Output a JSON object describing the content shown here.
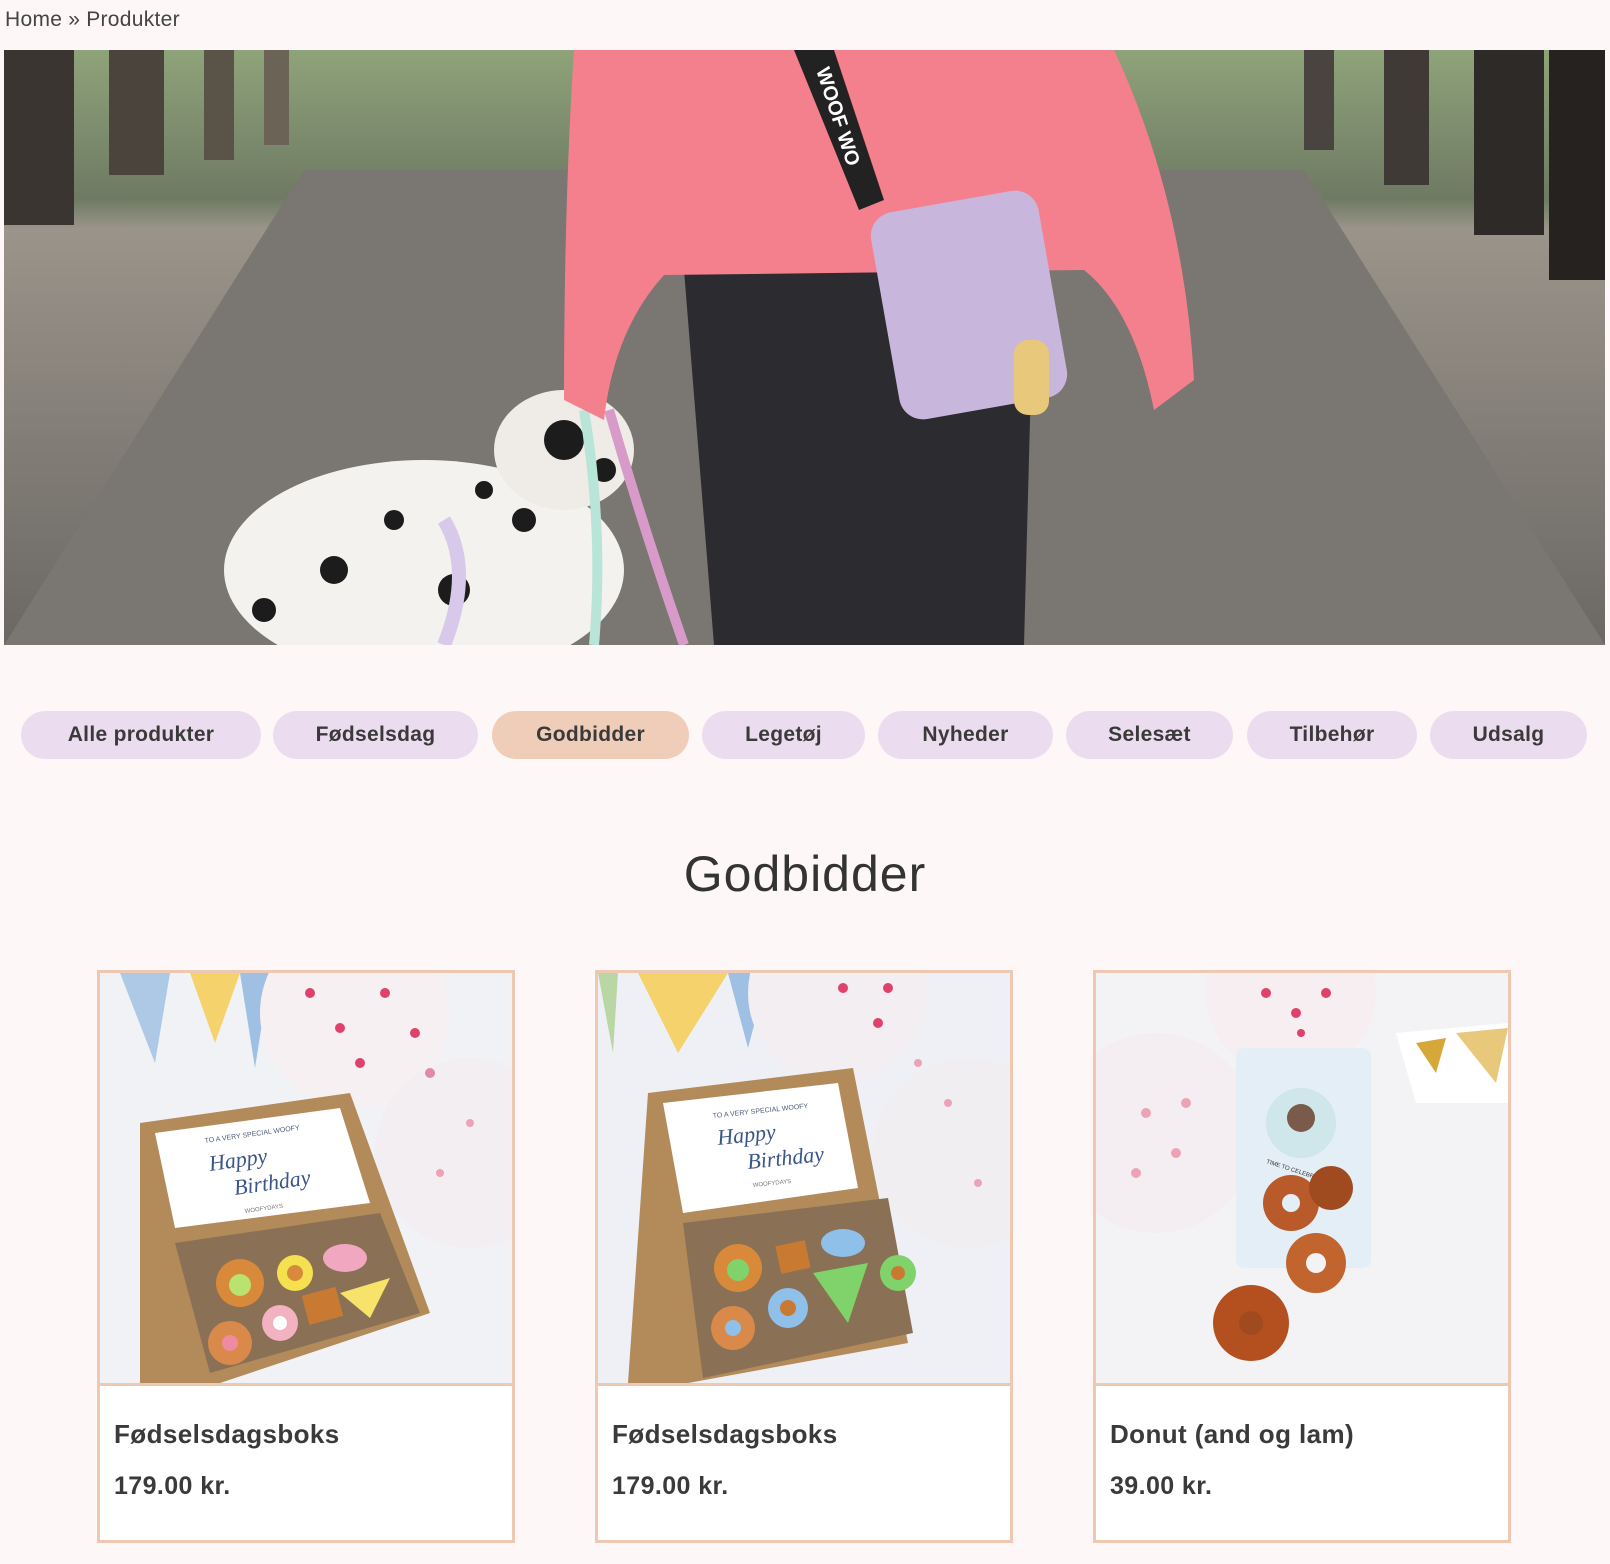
{
  "breadcrumb": {
    "home": "Home",
    "separator": "»",
    "current": "Produkter"
  },
  "hero": {
    "strap_text": "WOOF WO"
  },
  "filters": [
    {
      "label": "Alle produkter",
      "active": false
    },
    {
      "label": "Fødselsdag",
      "active": false
    },
    {
      "label": "Godbidder",
      "active": true
    },
    {
      "label": "Legetøj",
      "active": false
    },
    {
      "label": "Nyheder",
      "active": false
    },
    {
      "label": "Selesæt",
      "active": false
    },
    {
      "label": "Tilbehør",
      "active": false
    },
    {
      "label": "Udsalg",
      "active": false
    }
  ],
  "section_title": "Godbidder",
  "products": [
    {
      "name": "Fødselsdagsboks",
      "price": "179.00 kr.",
      "card_text": {
        "line1": "TO A VERY SPECIAL WOOFY",
        "script1": "Happy",
        "script2": "Birthday",
        "brand": "WOOFYDAYS"
      }
    },
    {
      "name": "Fødselsdagsboks",
      "price": "179.00 kr.",
      "card_text": {
        "line1": "TO A VERY SPECIAL WOOFY",
        "script1": "Happy",
        "script2": "Birthday",
        "brand": "WOOFYDAYS"
      }
    },
    {
      "name": "Donut (and og lam)",
      "price": "39.00 kr.",
      "label_text": "TIME TO CELEBRATE"
    }
  ],
  "colors": {
    "chip": "#ecdcef",
    "chip_active": "#f0cdb8",
    "card_border": "#efc8b1",
    "background": "#fdf8f7"
  }
}
